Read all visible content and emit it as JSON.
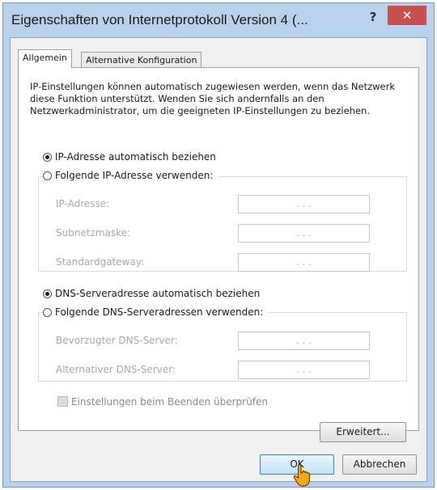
{
  "window": {
    "title": "Eigenschaften von Internetprotokoll Version 4 (...",
    "help_label": "?",
    "close_label": "✕"
  },
  "tabs": [
    {
      "label": "Allgemein",
      "active": true
    },
    {
      "label": "Alternative Konfiguration",
      "active": false
    }
  ],
  "info_text": "IP-Einstellungen können automatisch zugewiesen werden, wenn das Netzwerk diese Funktion unterstützt. Wenden Sie sich andernfalls an den Netzwerkadministrator, um die geeigneten IP-Einstellungen zu beziehen.",
  "ip_section": {
    "auto_label": "IP-Adresse automatisch beziehen",
    "auto_selected": true,
    "manual_label": "Folgende IP-Adresse verwenden:",
    "fields": [
      {
        "label": "IP-Adresse:",
        "value": ". . ."
      },
      {
        "label": "Subnetzmaske:",
        "value": ". . ."
      },
      {
        "label": "Standardgateway:",
        "value": ". . ."
      }
    ]
  },
  "dns_section": {
    "auto_label": "DNS-Serveradresse automatisch beziehen",
    "auto_selected": true,
    "manual_label": "Folgende DNS-Serveradressen verwenden:",
    "fields": [
      {
        "label": "Bevorzugter DNS-Server:",
        "value": ". . ."
      },
      {
        "label": "Alternativer DNS-Server:",
        "value": ". . ."
      }
    ]
  },
  "validate_label": "Einstellungen beim Beenden überprüfen",
  "validate_checked": false,
  "buttons": {
    "advanced": "Erweitert...",
    "ok": "OK",
    "cancel": "Abbrechen"
  },
  "icons": {
    "cursor": "hand-pointer-icon"
  }
}
